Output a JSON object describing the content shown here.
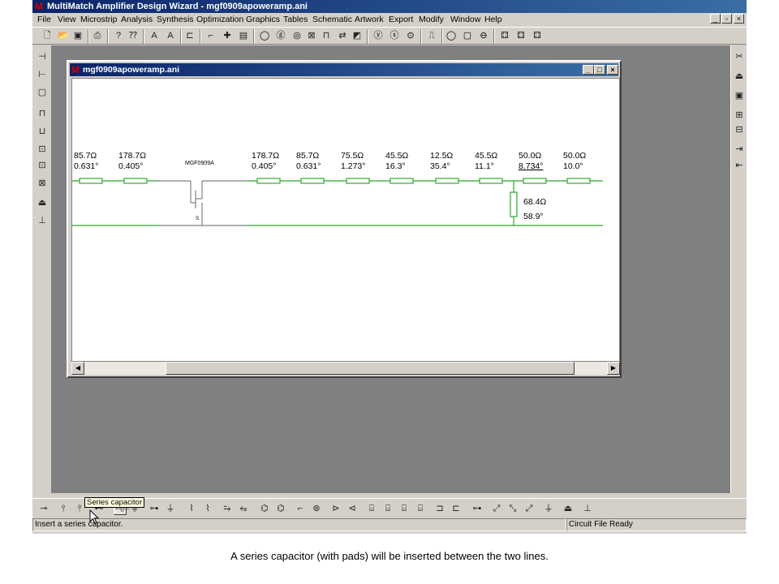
{
  "app": {
    "title": "MultiMatch Amplifier Design Wizard - mgf0909apoweramp.ani",
    "window_controls": [
      "_",
      "×"
    ]
  },
  "menu": [
    "File",
    "View",
    "Microstrip",
    "Analysis",
    "Synthesis",
    "Optimization",
    "Graphics",
    "Tables",
    "Schematic",
    "Artwork",
    "Export",
    "Modify",
    "Window",
    "Help"
  ],
  "child_window": {
    "title": "mgf0909apoweramp.ani",
    "controls": [
      "_",
      "□",
      "×"
    ]
  },
  "schematic": {
    "device_label": "MGF0909A",
    "source_label": "S",
    "input_lines": [
      {
        "z": "85.7Ω",
        "angle": "0.631°"
      },
      {
        "z": "178.7Ω",
        "angle": "0.405°"
      }
    ],
    "output_lines": [
      {
        "z": "178.7Ω",
        "angle": "0.405°"
      },
      {
        "z": "85.7Ω",
        "angle": "0.631°"
      },
      {
        "z": "75.5Ω",
        "angle": "1.273°"
      },
      {
        "z": "45.5Ω",
        "angle": "16.3°"
      },
      {
        "z": "12.5Ω",
        "angle": "35.4°"
      },
      {
        "z": "45.5Ω",
        "angle": "11.1°"
      },
      {
        "z": "50.0Ω",
        "angle": "8.734°"
      },
      {
        "z": "50.0Ω",
        "angle": "10.0°"
      }
    ],
    "shunt_stub": {
      "z": "68.4Ω",
      "angle": "58.9°"
    },
    "line_color": "#2ea82e"
  },
  "tooltip": "Series capacitor",
  "status": {
    "hint": "Insert a series capacitor.",
    "file_state": "Circuit File Ready"
  },
  "caption": "A series capacitor (with pads) will be inserted between the two lines."
}
